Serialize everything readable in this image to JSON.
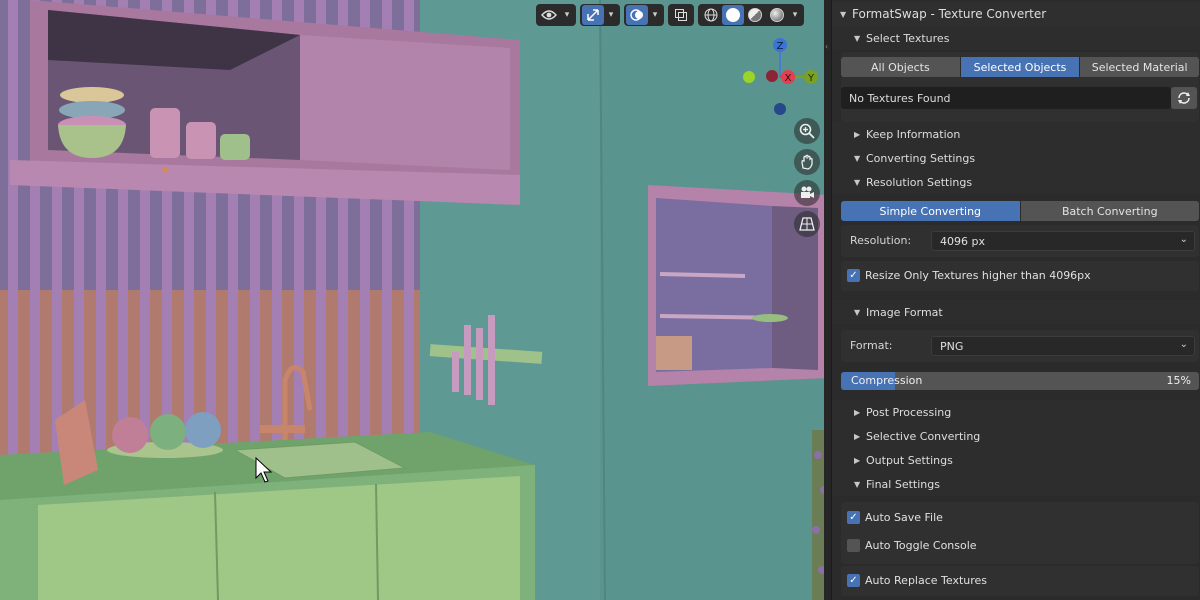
{
  "panel": {
    "title": "FormatSwap - Texture Converter",
    "select_textures": {
      "label": "Select Textures",
      "tabs": [
        "All Objects",
        "Selected Objects",
        "Selected Material"
      ],
      "active_tab": "Selected Objects",
      "status": "No Textures Found"
    },
    "sections": {
      "keep_information": "Keep Information",
      "converting_settings": "Converting Settings",
      "resolution_settings": "Resolution Settings",
      "image_format": "Image Format",
      "post_processing": "Post Processing",
      "selective_converting": "Selective Converting",
      "output_settings": "Output Settings",
      "final_settings": "Final Settings"
    },
    "resolution": {
      "modes": [
        "Simple Converting",
        "Batch Converting"
      ],
      "active_mode": "Simple Converting",
      "label": "Resolution:",
      "value": "4096 px",
      "resize_only_label": "Resize Only Textures higher than 4096px",
      "resize_only_checked": true
    },
    "format": {
      "label": "Format:",
      "value": "PNG",
      "compression_label": "Compression",
      "compression_value": "15%",
      "compression_fraction": 0.15
    },
    "final": {
      "auto_save_label": "Auto Save File",
      "auto_save_checked": true,
      "auto_toggle_label": "Auto Toggle Console",
      "auto_toggle_checked": false,
      "auto_replace_label": "Auto Replace Textures",
      "auto_replace_checked": true
    }
  },
  "viewport": {
    "gizmo": {
      "z": "Z",
      "x": "X",
      "y": "Y"
    },
    "icons": [
      "eye-icon",
      "gizmo-icon",
      "overlay-icon",
      "xray-icon",
      "wireframe-shading-icon",
      "solid-shading-icon",
      "material-shading-icon",
      "rendered-shading-icon",
      "zoom-icon",
      "hand-icon",
      "camera-icon",
      "grid-icon"
    ],
    "accent": "#4772b3"
  }
}
